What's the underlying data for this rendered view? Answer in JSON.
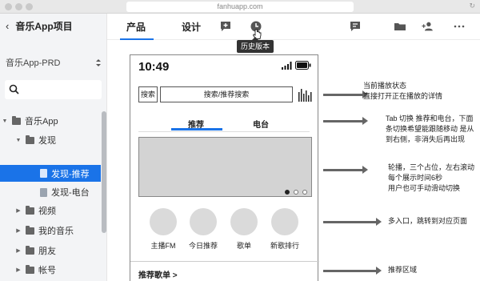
{
  "browser": {
    "url": "fanhuapp.com",
    "reload_icon": "reload-icon"
  },
  "sidebar": {
    "project_title": "音乐App项目",
    "prd_label": "音乐App-PRD",
    "tree": [
      {
        "label": "音乐App",
        "type": "folder",
        "expanded": true
      },
      {
        "label": "发现",
        "type": "folder",
        "expanded": true
      },
      {
        "label": "发现-推荐",
        "type": "page",
        "selected": true
      },
      {
        "label": "发现-电台",
        "type": "page"
      },
      {
        "label": "视频",
        "type": "folder"
      },
      {
        "label": "我的音乐",
        "type": "folder"
      },
      {
        "label": "朋友",
        "type": "folder"
      },
      {
        "label": "帐号",
        "type": "folder"
      }
    ]
  },
  "topbar": {
    "tabs": [
      "产品",
      "设计"
    ],
    "active_tab": "产品",
    "tooltip": "历史版本",
    "accent": "#1a73e8"
  },
  "phone": {
    "time": "10:49",
    "search_button": "搜索",
    "search_input": "搜索/推荐搜索",
    "tabs": [
      "推荐",
      "电台"
    ],
    "carousel_dots": 3,
    "carousel_active": 1,
    "entries": [
      "主播FM",
      "今日推荐",
      "歌单",
      "新歌排行"
    ],
    "recommend_header": "推荐歌单 >"
  },
  "annotations": [
    [
      "当前播放状态",
      "直接打开正在播放的详情"
    ],
    [
      "Tab 切换 推荐和电台，下面",
      "条切换希望能跟随移动 是从",
      "到右侧，非消失后再出现"
    ],
    [
      "轮播，三个占位，左右滚动",
      "每个展示时间6秒",
      "用户也可手动滑动切换"
    ],
    [
      "多入口，跳转到对应页面"
    ],
    [
      "推荐区域"
    ]
  ]
}
